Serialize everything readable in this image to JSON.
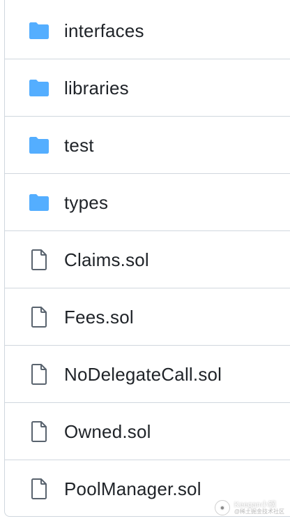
{
  "file_list": {
    "items": [
      {
        "name": "interfaces",
        "type": "folder"
      },
      {
        "name": "libraries",
        "type": "folder"
      },
      {
        "name": "test",
        "type": "folder"
      },
      {
        "name": "types",
        "type": "folder"
      },
      {
        "name": "Claims.sol",
        "type": "file"
      },
      {
        "name": "Fees.sol",
        "type": "file"
      },
      {
        "name": "NoDelegateCall.sol",
        "type": "file"
      },
      {
        "name": "Owned.sol",
        "type": "file"
      },
      {
        "name": "PoolManager.sol",
        "type": "file"
      }
    ]
  },
  "icons": {
    "folder": "folder-icon",
    "file": "file-icon"
  },
  "colors": {
    "folder": "#54aeff",
    "file_icon": "#59636e",
    "text": "#1f2328",
    "border": "#d0d7de"
  },
  "watermark": {
    "main": "Keegan小钢",
    "sub": "@稀土掘金技术社区"
  }
}
